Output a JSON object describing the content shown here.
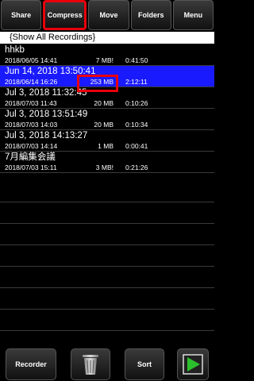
{
  "toolbar": {
    "share_label": "Share",
    "compress_label": "Compress",
    "move_label": "Move",
    "folders_label": "Folders",
    "menu_label": "Menu"
  },
  "filter": {
    "label": "{Show All Recordings}"
  },
  "recordings": [
    {
      "title": "hhkb",
      "date": "2018/06/05 14:41",
      "size": "7 MB!",
      "duration": "0:41:50"
    },
    {
      "title": "Jun 14, 2018 13:50:41",
      "date": "2018/06/14 16:26",
      "size": "253 MB",
      "duration": "2:12:11"
    },
    {
      "title": "Jul 3, 2018 11:32:45",
      "date": "2018/07/03 11:43",
      "size": "20 MB",
      "duration": "0:10:26"
    },
    {
      "title": "Jul 3, 2018 13:51:49",
      "date": "2018/07/03 14:03",
      "size": "20 MB",
      "duration": "0:10:34"
    },
    {
      "title": "Jul 3, 2018 14:13:27",
      "date": "2018/07/03 14:14",
      "size": "1 MB",
      "duration": "0:00:41"
    },
    {
      "title": "7月編集会議",
      "date": "2018/07/03 15:11",
      "size": "3 MB!",
      "duration": "0:21:26"
    }
  ],
  "bottom": {
    "recorder_label": "Recorder",
    "trash_icon": "trash-can-icon",
    "sort_label": "Sort",
    "play_icon": "play-icon"
  },
  "colors": {
    "selected_row": "#1a1aff",
    "highlight": "#e8000a"
  }
}
